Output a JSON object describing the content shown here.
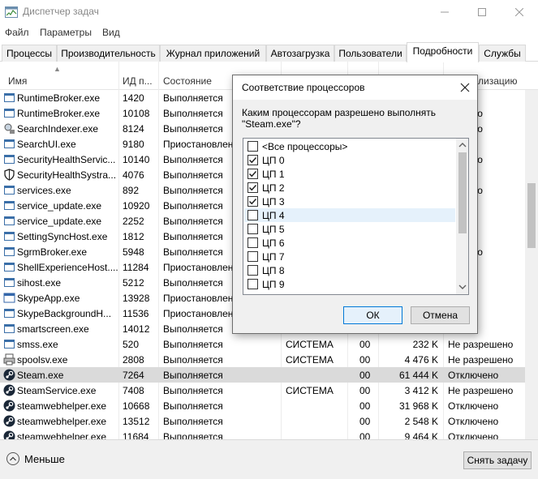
{
  "window": {
    "title": "Диспетчер задач"
  },
  "menu": [
    "Файл",
    "Параметры",
    "Вид"
  ],
  "tabs": [
    {
      "label": "Процессы",
      "active": false
    },
    {
      "label": "Производительность",
      "active": false
    },
    {
      "label": "Журнал приложений",
      "active": false
    },
    {
      "label": "Автозагрузка",
      "active": false
    },
    {
      "label": "Пользователи",
      "active": false
    },
    {
      "label": "Подробности",
      "active": true
    },
    {
      "label": "Службы",
      "active": false
    }
  ],
  "table": {
    "columns": [
      "Имя",
      "ИД п...",
      "Состояние",
      "",
      "",
      "",
      "лизацию"
    ],
    "rows": [
      {
        "name": "RuntimeBroker.exe",
        "pid": "1420",
        "status": "Выполняется",
        "user": "",
        "cpu": "",
        "mem": "",
        "virt": "ено",
        "icon": "window-icon"
      },
      {
        "name": "RuntimeBroker.exe",
        "pid": "10108",
        "status": "Выполняется",
        "user": "",
        "cpu": "",
        "mem": "",
        "virt": "решено",
        "icon": "window-icon"
      },
      {
        "name": "SearchIndexer.exe",
        "pid": "8124",
        "status": "Выполняется",
        "user": "",
        "cpu": "",
        "mem": "",
        "virt": "решено",
        "icon": "search-indexer-icon"
      },
      {
        "name": "SearchUI.exe",
        "pid": "9180",
        "status": "Приостановлен",
        "user": "",
        "cpu": "",
        "mem": "",
        "virt": "ено",
        "icon": "window-icon"
      },
      {
        "name": "SecurityHealthServic...",
        "pid": "10140",
        "status": "Выполняется",
        "user": "",
        "cpu": "",
        "mem": "",
        "virt": "решено",
        "icon": "window-icon"
      },
      {
        "name": "SecurityHealthSystra...",
        "pid": "4076",
        "status": "Выполняется",
        "user": "",
        "cpu": "",
        "mem": "",
        "virt": "ено",
        "icon": "shield-icon"
      },
      {
        "name": "services.exe",
        "pid": "892",
        "status": "Выполняется",
        "user": "",
        "cpu": "",
        "mem": "",
        "virt": "решено",
        "icon": "window-icon"
      },
      {
        "name": "service_update.exe",
        "pid": "10920",
        "status": "Выполняется",
        "user": "",
        "cpu": "",
        "mem": "",
        "virt": "ено",
        "icon": "window-icon"
      },
      {
        "name": "service_update.exe",
        "pid": "2252",
        "status": "Выполняется",
        "user": "",
        "cpu": "",
        "mem": "",
        "virt": "ено",
        "icon": "window-icon"
      },
      {
        "name": "SettingSyncHost.exe",
        "pid": "1812",
        "status": "Выполняется",
        "user": "",
        "cpu": "",
        "mem": "",
        "virt": "ено",
        "icon": "window-icon"
      },
      {
        "name": "SgrmBroker.exe",
        "pid": "5948",
        "status": "Выполняется",
        "user": "",
        "cpu": "",
        "mem": "",
        "virt": "решено",
        "icon": "window-icon"
      },
      {
        "name": "ShellExperienceHost....",
        "pid": "11284",
        "status": "Приостановлен",
        "user": "",
        "cpu": "",
        "mem": "",
        "virt": "ено",
        "icon": "window-icon"
      },
      {
        "name": "sihost.exe",
        "pid": "5212",
        "status": "Выполняется",
        "user": "",
        "cpu": "",
        "mem": "",
        "virt": "ено",
        "icon": "window-icon"
      },
      {
        "name": "SkypeApp.exe",
        "pid": "13928",
        "status": "Приостановлен",
        "user": "",
        "cpu": "",
        "mem": "",
        "virt": "ено",
        "icon": "skype-icon"
      },
      {
        "name": "SkypeBackgroundH...",
        "pid": "11536",
        "status": "Приостановлен",
        "user": "",
        "cpu": "",
        "mem": "",
        "virt": "ено",
        "icon": "window-icon"
      },
      {
        "name": "smartscreen.exe",
        "pid": "14012",
        "status": "Выполняется",
        "user": "",
        "cpu": "",
        "mem": "",
        "virt": "ено",
        "icon": "window-icon"
      },
      {
        "name": "smss.exe",
        "pid": "520",
        "status": "Выполняется",
        "user": "СИСТЕМА",
        "cpu": "00",
        "mem": "232 K",
        "virt": "Не разрешено",
        "icon": "window-icon"
      },
      {
        "name": "spoolsv.exe",
        "pid": "2808",
        "status": "Выполняется",
        "user": "СИСТЕМА",
        "cpu": "00",
        "mem": "4 476 K",
        "virt": "Не разрешено",
        "icon": "printer-icon"
      },
      {
        "name": "Steam.exe",
        "pid": "7264",
        "status": "Выполняется",
        "user": "",
        "cpu": "00",
        "mem": "61 444 K",
        "virt": "Отключено",
        "icon": "steam-icon",
        "selected": true
      },
      {
        "name": "SteamService.exe",
        "pid": "7408",
        "status": "Выполняется",
        "user": "СИСТЕМА",
        "cpu": "00",
        "mem": "3 412 K",
        "virt": "Не разрешено",
        "icon": "steam-icon"
      },
      {
        "name": "steamwebhelper.exe",
        "pid": "10668",
        "status": "Выполняется",
        "user": "",
        "cpu": "00",
        "mem": "31 968 K",
        "virt": "Отключено",
        "icon": "steam-icon"
      },
      {
        "name": "steamwebhelper.exe",
        "pid": "13512",
        "status": "Выполняется",
        "user": "",
        "cpu": "00",
        "mem": "2 548 K",
        "virt": "Отключено",
        "icon": "steam-icon"
      },
      {
        "name": "steamwebhelper.exe",
        "pid": "11684",
        "status": "Выполняется",
        "user": "",
        "cpu": "00",
        "mem": "9 464 K",
        "virt": "Отключено",
        "icon": "steam-icon"
      }
    ]
  },
  "bottom": {
    "less_label": "Меньше",
    "end_task_label": "Снять задачу"
  },
  "dialog": {
    "title": "Соответствие процессоров",
    "prompt": "Каким процессорам разрешено выполнять \"Steam.exe\"?",
    "items": [
      {
        "label": "<Все процессоры>",
        "checked": false
      },
      {
        "label": "ЦП 0",
        "checked": true
      },
      {
        "label": "ЦП 1",
        "checked": true
      },
      {
        "label": "ЦП 2",
        "checked": true
      },
      {
        "label": "ЦП 3",
        "checked": true
      },
      {
        "label": "ЦП 4",
        "checked": false,
        "focused": true
      },
      {
        "label": "ЦП 5",
        "checked": false
      },
      {
        "label": "ЦП 6",
        "checked": false
      },
      {
        "label": "ЦП 7",
        "checked": false
      },
      {
        "label": "ЦП 8",
        "checked": false
      },
      {
        "label": "ЦП 9",
        "checked": false
      }
    ],
    "ok_label": "ОК",
    "cancel_label": "Отмена"
  },
  "colors": {
    "selected_row": "#dadada",
    "focus_item": "#e5f1fb",
    "accent": "#0078d7",
    "steam": "#1b2838"
  }
}
